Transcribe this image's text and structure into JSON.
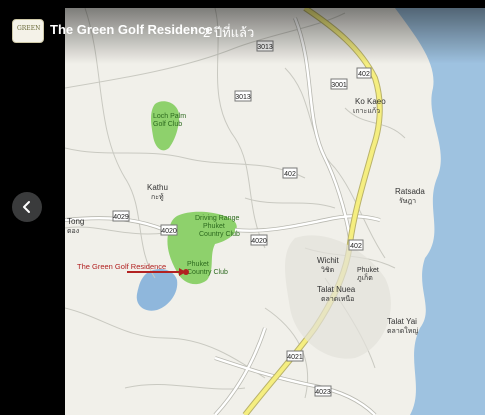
{
  "header": {
    "page_name": "The Green Golf Residence",
    "separator": "·",
    "time_ago": "2 ปีที่แล้ว"
  },
  "controls": {
    "prev_icon": "chevron-left-icon"
  },
  "map": {
    "annotation": "The Green Golf Residence",
    "places": {
      "ko_kaeo": "Ko Kaeo",
      "ko_kaeo_th": "เกาะแก้ว",
      "ratsada": "Ratsada",
      "ratsada_th": "รัษฎา",
      "kathu": "Kathu",
      "kathu_th": "กะทู้",
      "tong": "Tong",
      "tong_th": "ตอง",
      "wichit": "Wichit",
      "wichit_th": "วิชิต",
      "talat_nuea": "Talat Nuea",
      "talat_nuea_th": "ตลาดเหนือ",
      "talat_yai": "Talat Yai",
      "talat_yai_th": "ตลาดใหญ่",
      "phuket": "Phuket",
      "phuket_th": "ภูเก็ต",
      "loch_palm_1": "Loch Palm",
      "loch_palm_2": "Golf Club",
      "driving_range_1": "Driving Range",
      "driving_range_2": "Phuket",
      "driving_range_3": "Country Club",
      "phuket_cc_1": "Phuket",
      "phuket_cc_2": "Country Club"
    },
    "routes": {
      "r3013_a": "3013",
      "r3013_b": "3013",
      "r402_top": "402",
      "r3001": "3001",
      "r402_mid": "402",
      "r402_low": "402",
      "r4029": "4029",
      "r4020": "4020",
      "r4020_b": "4020",
      "r4021": "4021",
      "r4023": "4023"
    }
  }
}
